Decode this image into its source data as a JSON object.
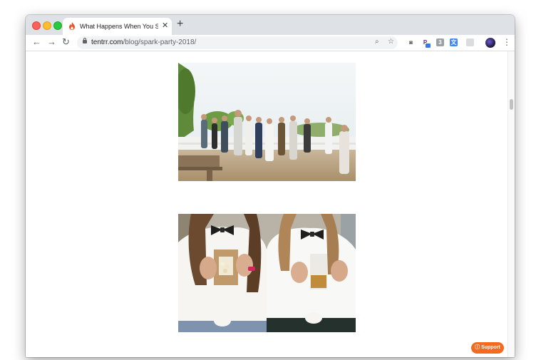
{
  "browser": {
    "tab": {
      "title": "What Happens When You Send",
      "close_glyph": "✕",
      "favicon": "tentrr-flame-icon"
    },
    "new_tab_glyph": "+",
    "nav": {
      "back_glyph": "←",
      "forward_glyph": "→",
      "reload_glyph": "↻"
    },
    "url": {
      "domain": "tentrr.com",
      "path": "/blog/spark-party-2018/"
    },
    "omnibox_icons": {
      "zoom_glyph": "⌕",
      "star_glyph": "☆"
    },
    "extensions": [
      {
        "name": "camera-icon",
        "glyph": "◙"
      },
      {
        "name": "p-extension-icon",
        "glyph": "P"
      },
      {
        "name": "grey-extension-icon",
        "glyph": "3"
      },
      {
        "name": "translate-icon",
        "glyph": "文"
      },
      {
        "name": "bookmark-icon",
        "glyph": ""
      }
    ],
    "menu_glyph": "⋮"
  },
  "page": {
    "photos": [
      {
        "name": "party-group-photo",
        "subject": "outdoor party group"
      },
      {
        "name": "bowtie-favors-photo",
        "subject": "two people holding favor bags"
      }
    ],
    "support_button": {
      "label": "Support",
      "icon": "help-circle-icon"
    }
  },
  "colors": {
    "support": "#f26b21",
    "tab_strip": "#dee1e6"
  }
}
